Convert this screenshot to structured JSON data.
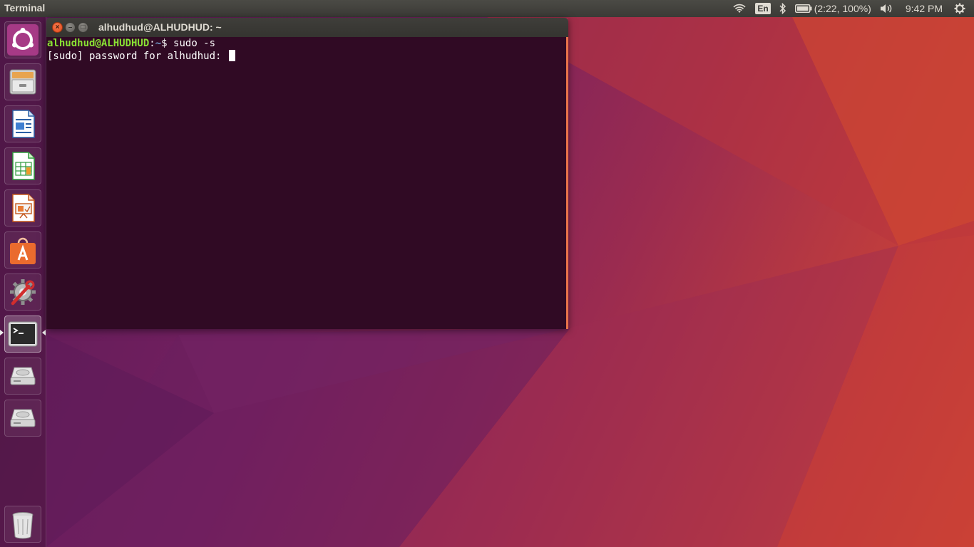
{
  "top_panel": {
    "app_title": "Terminal",
    "keyboard_layout": "En",
    "battery_text": "(2:22, 100%)",
    "clock": "9:42 PM",
    "icons": [
      "wifi-icon",
      "bluetooth-icon",
      "battery-icon",
      "volume-icon",
      "settings-gear-icon"
    ]
  },
  "launcher": {
    "items": [
      {
        "name": "dash-home",
        "icon": "ubuntu-logo-icon"
      },
      {
        "name": "files",
        "icon": "file-cabinet-icon"
      },
      {
        "name": "libreoffice-writer",
        "icon": "writer-document-icon"
      },
      {
        "name": "libreoffice-calc",
        "icon": "calc-spreadsheet-icon"
      },
      {
        "name": "libreoffice-impress",
        "icon": "impress-presentation-icon"
      },
      {
        "name": "ubuntu-software",
        "icon": "software-bag-icon"
      },
      {
        "name": "system-settings",
        "icon": "settings-wrench-icon"
      },
      {
        "name": "terminal",
        "icon": "terminal-icon",
        "active": true
      },
      {
        "name": "drive-1",
        "icon": "hard-drive-icon"
      },
      {
        "name": "drive-2",
        "icon": "hard-drive-icon"
      },
      {
        "name": "trash",
        "icon": "trash-icon"
      }
    ]
  },
  "window": {
    "title": "alhudhud@ALHUDHUD: ~",
    "close_glyph": "×",
    "minimize_glyph": "–",
    "maximize_glyph": "□"
  },
  "terminal": {
    "prompt_user": "alhudhud@ALHUDHUD",
    "prompt_sep": ":",
    "prompt_path": "~",
    "prompt_symbol": "$ ",
    "command": "sudo -s",
    "line2": "[sudo] password for alhudhud: "
  },
  "colors": {
    "terminal_bg": "#300a24",
    "prompt_user": "#8ae234",
    "prompt_path": "#729fcf",
    "window_close": "#e14a1d",
    "accent_border": "#e9734a"
  }
}
